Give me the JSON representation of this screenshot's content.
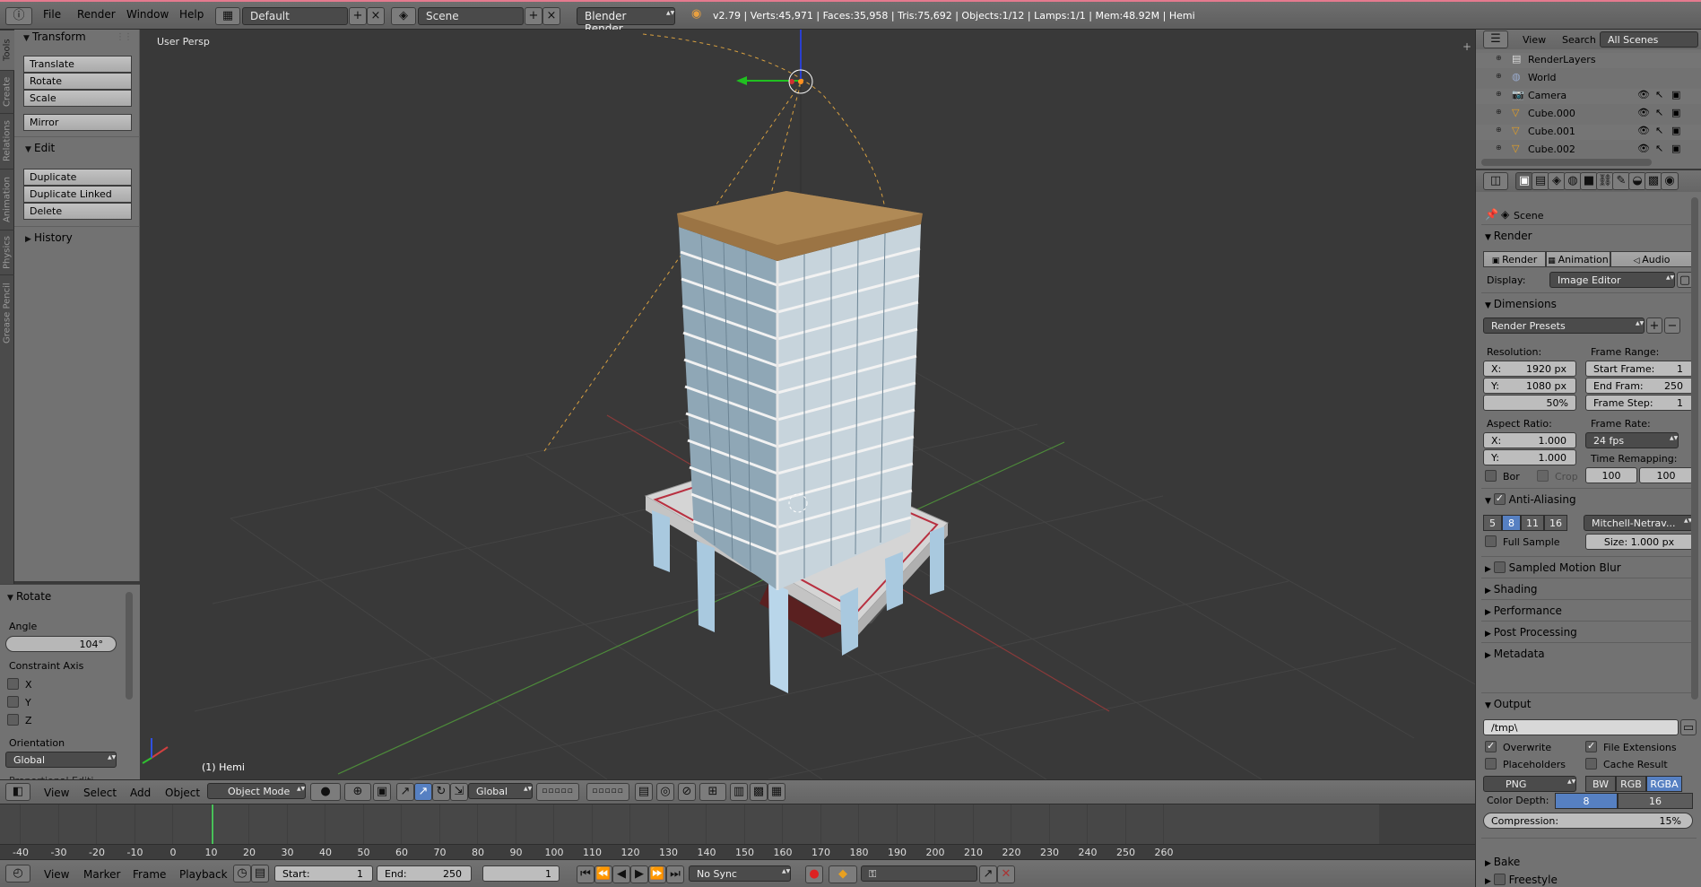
{
  "topbar": {
    "menus": [
      "File",
      "Render",
      "Window",
      "Help"
    ],
    "layout": "Default",
    "scene": "Scene",
    "engine": "Blender Render",
    "stats": "v2.79 | Verts:45,971 | Faces:35,958 | Tris:75,692 | Objects:1/12 | Lamps:1/1 | Mem:48.92M | Hemi"
  },
  "shelf_tabs": [
    "Tools",
    "Create",
    "Relations",
    "Animation",
    "Physics",
    "Grease Pencil"
  ],
  "tool_shelf": {
    "transform_title": "Transform",
    "translate": "Translate",
    "rotate": "Rotate",
    "scale": "Scale",
    "mirror": "Mirror",
    "edit_title": "Edit",
    "duplicate": "Duplicate",
    "duplicate_linked": "Duplicate Linked",
    "delete": "Delete",
    "history_title": "History"
  },
  "operator_panel": {
    "title": "Rotate",
    "angle_label": "Angle",
    "angle_value": "104°",
    "constraint_label": "Constraint Axis",
    "axes": [
      "X",
      "Y",
      "Z"
    ],
    "orientation_label": "Orientation",
    "orientation_value": "Global",
    "cut_label": "Proportional Editi..."
  },
  "viewport": {
    "view_name": "User Persp",
    "object_name": "(1) Hemi"
  },
  "view3d_header": {
    "menus": [
      "View",
      "Select",
      "Add",
      "Object"
    ],
    "mode": "Object Mode",
    "orientation": "Global"
  },
  "timeline": {
    "ticks": [
      "-40",
      "-30",
      "-20",
      "-10",
      "0",
      "10",
      "20",
      "30",
      "40",
      "50",
      "60",
      "70",
      "80",
      "90",
      "100",
      "110",
      "120",
      "130",
      "140",
      "150",
      "160",
      "170",
      "180",
      "190",
      "200",
      "210",
      "220",
      "230",
      "240",
      "250",
      "260"
    ],
    "menus": [
      "View",
      "Marker",
      "Frame",
      "Playback"
    ],
    "start_label": "Start:",
    "start_value": "1",
    "end_label": "End:",
    "end_value": "250",
    "current_frame": "1",
    "sync": "No Sync"
  },
  "outliner": {
    "menus": [
      "View",
      "Search"
    ],
    "filter": "All Scenes",
    "items": [
      "RenderLayers",
      "World",
      "Camera",
      "Cube.000",
      "Cube.001",
      "Cube.002"
    ]
  },
  "properties": {
    "context": "Scene",
    "render_title": "Render",
    "render_btns": [
      "Render",
      "Animation",
      "Audio"
    ],
    "display_label": "Display:",
    "display_value": "Image Editor",
    "dimensions_title": "Dimensions",
    "presets": "Render Presets",
    "resolution_label": "Resolution:",
    "res_x": "X:",
    "res_x_val": "1920 px",
    "res_y": "Y:",
    "res_y_val": "1080 px",
    "res_pct": "50%",
    "frame_range_label": "Frame Range:",
    "start_frame": "Start Frame:",
    "start_frame_val": "1",
    "end_frame": "End Fram:",
    "end_frame_val": "250",
    "frame_step": "Frame Step:",
    "frame_step_val": "1",
    "aspect_label": "Aspect Ratio:",
    "asp_x": "X:",
    "asp_x_val": "1.000",
    "asp_y": "Y:",
    "asp_y_val": "1.000",
    "frame_rate_label": "Frame Rate:",
    "frame_rate": "24 fps",
    "time_remap_label": "Time Remapping:",
    "remap_old": "100",
    "remap_new": "100",
    "bor": "Bor",
    "crop": "Crop",
    "aa_title": "Anti-Aliasing",
    "aa_samples": [
      "5",
      "8",
      "11",
      "16"
    ],
    "aa_filter": "Mitchell-Netrav...",
    "full_sample": "Full Sample",
    "aa_size": "Size: 1.000 px",
    "collapsed_panels": [
      "Sampled Motion Blur",
      "Shading",
      "Performance",
      "Post Processing",
      "Metadata"
    ],
    "output_title": "Output",
    "output_path": "/tmp\\",
    "overwrite": "Overwrite",
    "file_ext": "File Extensions",
    "placeholders": "Placeholders",
    "cache_result": "Cache Result",
    "format": "PNG",
    "color_modes": [
      "BW",
      "RGB",
      "RGBA"
    ],
    "color_depth_label": "Color Depth:",
    "depths": [
      "8",
      "16"
    ],
    "compression": "Compression:",
    "compression_val": "15%",
    "bake_title": "Bake",
    "freestyle_title": "Freestyle"
  }
}
